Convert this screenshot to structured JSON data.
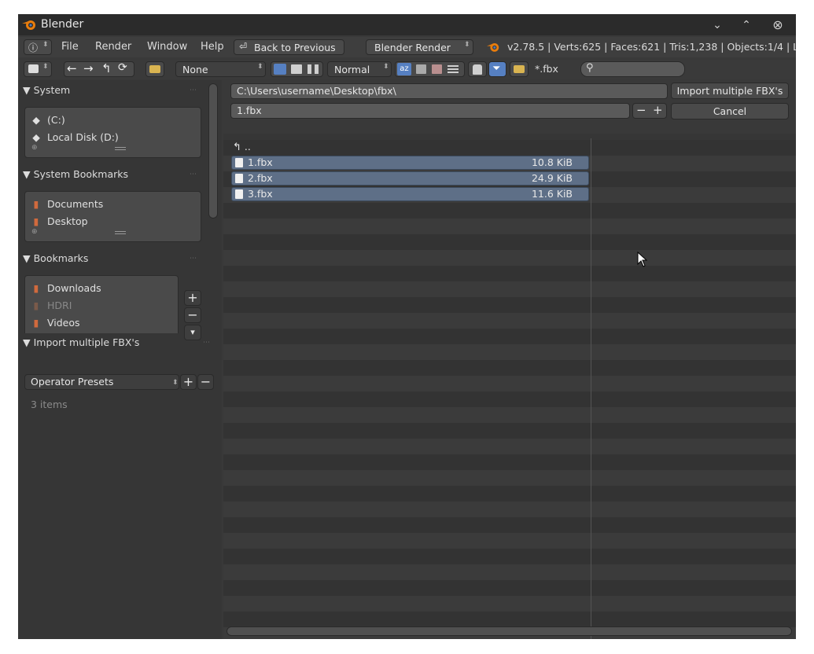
{
  "window": {
    "title": "Blender",
    "controls": [
      "⌄",
      "⌃",
      "⊗"
    ]
  },
  "menubar": {
    "items": [
      "File",
      "Render",
      "Window",
      "Help"
    ],
    "back_button": "Back to Previous",
    "render_engine": "Blender Render",
    "stats": "v2.78.5 | Verts:625 | Faces:621 | Tris:1,238 | Objects:1/4 | L"
  },
  "toolbar": {
    "recent_select": "None",
    "sort_select": "Normal",
    "filter_glob": "*.fbx",
    "search_placeholder": ""
  },
  "sidebar": {
    "system": {
      "header": "System",
      "items": [
        {
          "label": "(C:)",
          "icon": "disk-icon"
        },
        {
          "label": "Local Disk (D:)",
          "icon": "disk-icon"
        }
      ]
    },
    "system_bookmarks": {
      "header": "System Bookmarks",
      "items": [
        {
          "label": "Documents",
          "icon": "folder-icon"
        },
        {
          "label": "Desktop",
          "icon": "folder-icon"
        }
      ]
    },
    "bookmarks": {
      "header": "Bookmarks",
      "items": [
        {
          "label": "Downloads",
          "icon": "folder-icon",
          "dim": false
        },
        {
          "label": "HDRI",
          "icon": "folder-icon",
          "dim": true
        },
        {
          "label": "Videos",
          "icon": "folder-icon",
          "dim": false
        }
      ]
    },
    "operator": {
      "header": "Import multiple FBX's",
      "presets": "Operator Presets",
      "count": "3 items"
    }
  },
  "main": {
    "path": "C:\\Users\\username\\Desktop\\fbx\\",
    "filename": "1.fbx",
    "import_button": "Import multiple FBX's",
    "cancel_button": "Cancel",
    "parent_dir": "..",
    "files": [
      {
        "name": "1.fbx",
        "size": "10.8 KiB"
      },
      {
        "name": "2.fbx",
        "size": "24.9 KiB"
      },
      {
        "name": "3.fbx",
        "size": "11.6 KiB"
      }
    ]
  },
  "colors": {
    "selection": "#5e6f87",
    "accent": "#e87d0d",
    "window_bg": "#393939"
  }
}
